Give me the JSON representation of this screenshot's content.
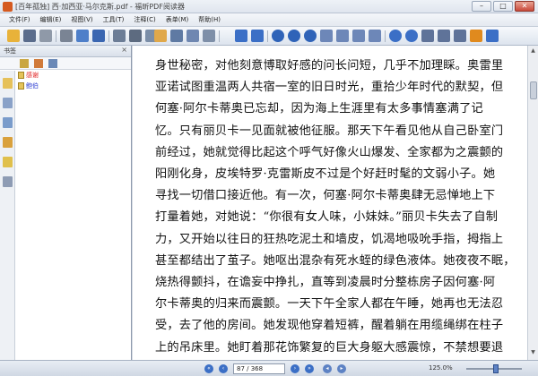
{
  "window": {
    "title": "[百年孤独] 西·加西亚·马尔克斯.pdf - 福昕PDF阅读器",
    "minimize": "–",
    "maximize": "□",
    "close": "✕"
  },
  "menu": [
    "文件(F)",
    "编辑(E)",
    "视图(V)",
    "工具(T)",
    "注释(C)",
    "表单(M)",
    "帮助(H)"
  ],
  "sidebar": {
    "header": "书签",
    "close": "×",
    "bookmarks": [
      {
        "label": "感谢",
        "color": "#e02020"
      },
      {
        "label": "鲍伯",
        "color": "#2a3bd0"
      }
    ]
  },
  "document": {
    "lines": [
      "身世秘密，对他刻意博取好感的问长问短，几乎不加理睬。奥雷里",
      "亚诺试图重温两人共宿一室的旧日时光，重拾少年时代的默契，但",
      "何塞·阿尔卡蒂奥已忘却，因为海上生涯里有太多事情塞满了记",
      "忆。只有丽贝卡一见面就被他征服。那天下午看见他从自己卧室门",
      "前经过，她就觉得比起这个呼气好像火山爆发、全家都为之震颤的",
      "阳刚化身，皮埃特罗·克雷斯皮不过是个好赶时髦的文弱小子。她",
      "寻找一切借口接近他。有一次，何塞·阿尔卡蒂奥肆无忌惮地上下",
      "打量着她，对她说：“你很有女人味，小妹妹。”丽贝卡失去了自制",
      "力，又开始以往日的狂热吃泥土和墙皮，饥渴地吸吮手指，拇指上",
      "甚至都结出了茧子。她呕出混杂有死水蛭的绿色液体。她夜夜不眠，",
      "烧热得颤抖，在谵妄中挣扎，直等到凌晨时分整栋房子因何塞·阿",
      "尔卡蒂奥的归来而震颤。一天下午全家人都在午睡，她再也无法忍",
      "受，去了他的房间。她发现他穿着短裤，醒着躺在用缆绳绑在柱子",
      "上的吊床里。她盯着那花饰繁复的巨大身躯大感震惊，不禁想要退"
    ]
  },
  "status": {
    "page_current": "87",
    "page_total": "368",
    "page_display": "87 / 368",
    "zoom": "125.0%"
  },
  "colors": {
    "toolbar_icon_blue": "#3b6fc6",
    "toolbar_icon_orange": "#e08a1e",
    "accent": "#5d82c4"
  }
}
